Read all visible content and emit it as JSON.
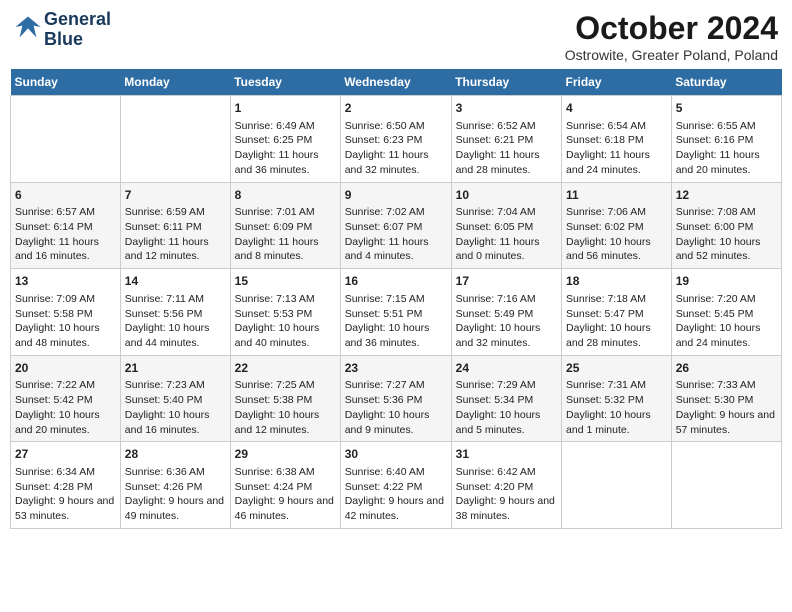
{
  "header": {
    "logo_line1": "General",
    "logo_line2": "Blue",
    "month": "October 2024",
    "location": "Ostrowite, Greater Poland, Poland"
  },
  "days_of_week": [
    "Sunday",
    "Monday",
    "Tuesday",
    "Wednesday",
    "Thursday",
    "Friday",
    "Saturday"
  ],
  "weeks": [
    [
      {
        "day": "",
        "sunrise": "",
        "sunset": "",
        "daylight": ""
      },
      {
        "day": "",
        "sunrise": "",
        "sunset": "",
        "daylight": ""
      },
      {
        "day": "1",
        "sunrise": "Sunrise: 6:49 AM",
        "sunset": "Sunset: 6:25 PM",
        "daylight": "Daylight: 11 hours and 36 minutes."
      },
      {
        "day": "2",
        "sunrise": "Sunrise: 6:50 AM",
        "sunset": "Sunset: 6:23 PM",
        "daylight": "Daylight: 11 hours and 32 minutes."
      },
      {
        "day": "3",
        "sunrise": "Sunrise: 6:52 AM",
        "sunset": "Sunset: 6:21 PM",
        "daylight": "Daylight: 11 hours and 28 minutes."
      },
      {
        "day": "4",
        "sunrise": "Sunrise: 6:54 AM",
        "sunset": "Sunset: 6:18 PM",
        "daylight": "Daylight: 11 hours and 24 minutes."
      },
      {
        "day": "5",
        "sunrise": "Sunrise: 6:55 AM",
        "sunset": "Sunset: 6:16 PM",
        "daylight": "Daylight: 11 hours and 20 minutes."
      }
    ],
    [
      {
        "day": "6",
        "sunrise": "Sunrise: 6:57 AM",
        "sunset": "Sunset: 6:14 PM",
        "daylight": "Daylight: 11 hours and 16 minutes."
      },
      {
        "day": "7",
        "sunrise": "Sunrise: 6:59 AM",
        "sunset": "Sunset: 6:11 PM",
        "daylight": "Daylight: 11 hours and 12 minutes."
      },
      {
        "day": "8",
        "sunrise": "Sunrise: 7:01 AM",
        "sunset": "Sunset: 6:09 PM",
        "daylight": "Daylight: 11 hours and 8 minutes."
      },
      {
        "day": "9",
        "sunrise": "Sunrise: 7:02 AM",
        "sunset": "Sunset: 6:07 PM",
        "daylight": "Daylight: 11 hours and 4 minutes."
      },
      {
        "day": "10",
        "sunrise": "Sunrise: 7:04 AM",
        "sunset": "Sunset: 6:05 PM",
        "daylight": "Daylight: 11 hours and 0 minutes."
      },
      {
        "day": "11",
        "sunrise": "Sunrise: 7:06 AM",
        "sunset": "Sunset: 6:02 PM",
        "daylight": "Daylight: 10 hours and 56 minutes."
      },
      {
        "day": "12",
        "sunrise": "Sunrise: 7:08 AM",
        "sunset": "Sunset: 6:00 PM",
        "daylight": "Daylight: 10 hours and 52 minutes."
      }
    ],
    [
      {
        "day": "13",
        "sunrise": "Sunrise: 7:09 AM",
        "sunset": "Sunset: 5:58 PM",
        "daylight": "Daylight: 10 hours and 48 minutes."
      },
      {
        "day": "14",
        "sunrise": "Sunrise: 7:11 AM",
        "sunset": "Sunset: 5:56 PM",
        "daylight": "Daylight: 10 hours and 44 minutes."
      },
      {
        "day": "15",
        "sunrise": "Sunrise: 7:13 AM",
        "sunset": "Sunset: 5:53 PM",
        "daylight": "Daylight: 10 hours and 40 minutes."
      },
      {
        "day": "16",
        "sunrise": "Sunrise: 7:15 AM",
        "sunset": "Sunset: 5:51 PM",
        "daylight": "Daylight: 10 hours and 36 minutes."
      },
      {
        "day": "17",
        "sunrise": "Sunrise: 7:16 AM",
        "sunset": "Sunset: 5:49 PM",
        "daylight": "Daylight: 10 hours and 32 minutes."
      },
      {
        "day": "18",
        "sunrise": "Sunrise: 7:18 AM",
        "sunset": "Sunset: 5:47 PM",
        "daylight": "Daylight: 10 hours and 28 minutes."
      },
      {
        "day": "19",
        "sunrise": "Sunrise: 7:20 AM",
        "sunset": "Sunset: 5:45 PM",
        "daylight": "Daylight: 10 hours and 24 minutes."
      }
    ],
    [
      {
        "day": "20",
        "sunrise": "Sunrise: 7:22 AM",
        "sunset": "Sunset: 5:42 PM",
        "daylight": "Daylight: 10 hours and 20 minutes."
      },
      {
        "day": "21",
        "sunrise": "Sunrise: 7:23 AM",
        "sunset": "Sunset: 5:40 PM",
        "daylight": "Daylight: 10 hours and 16 minutes."
      },
      {
        "day": "22",
        "sunrise": "Sunrise: 7:25 AM",
        "sunset": "Sunset: 5:38 PM",
        "daylight": "Daylight: 10 hours and 12 minutes."
      },
      {
        "day": "23",
        "sunrise": "Sunrise: 7:27 AM",
        "sunset": "Sunset: 5:36 PM",
        "daylight": "Daylight: 10 hours and 9 minutes."
      },
      {
        "day": "24",
        "sunrise": "Sunrise: 7:29 AM",
        "sunset": "Sunset: 5:34 PM",
        "daylight": "Daylight: 10 hours and 5 minutes."
      },
      {
        "day": "25",
        "sunrise": "Sunrise: 7:31 AM",
        "sunset": "Sunset: 5:32 PM",
        "daylight": "Daylight: 10 hours and 1 minute."
      },
      {
        "day": "26",
        "sunrise": "Sunrise: 7:33 AM",
        "sunset": "Sunset: 5:30 PM",
        "daylight": "Daylight: 9 hours and 57 minutes."
      }
    ],
    [
      {
        "day": "27",
        "sunrise": "Sunrise: 6:34 AM",
        "sunset": "Sunset: 4:28 PM",
        "daylight": "Daylight: 9 hours and 53 minutes."
      },
      {
        "day": "28",
        "sunrise": "Sunrise: 6:36 AM",
        "sunset": "Sunset: 4:26 PM",
        "daylight": "Daylight: 9 hours and 49 minutes."
      },
      {
        "day": "29",
        "sunrise": "Sunrise: 6:38 AM",
        "sunset": "Sunset: 4:24 PM",
        "daylight": "Daylight: 9 hours and 46 minutes."
      },
      {
        "day": "30",
        "sunrise": "Sunrise: 6:40 AM",
        "sunset": "Sunset: 4:22 PM",
        "daylight": "Daylight: 9 hours and 42 minutes."
      },
      {
        "day": "31",
        "sunrise": "Sunrise: 6:42 AM",
        "sunset": "Sunset: 4:20 PM",
        "daylight": "Daylight: 9 hours and 38 minutes."
      },
      {
        "day": "",
        "sunrise": "",
        "sunset": "",
        "daylight": ""
      },
      {
        "day": "",
        "sunrise": "",
        "sunset": "",
        "daylight": ""
      }
    ]
  ]
}
